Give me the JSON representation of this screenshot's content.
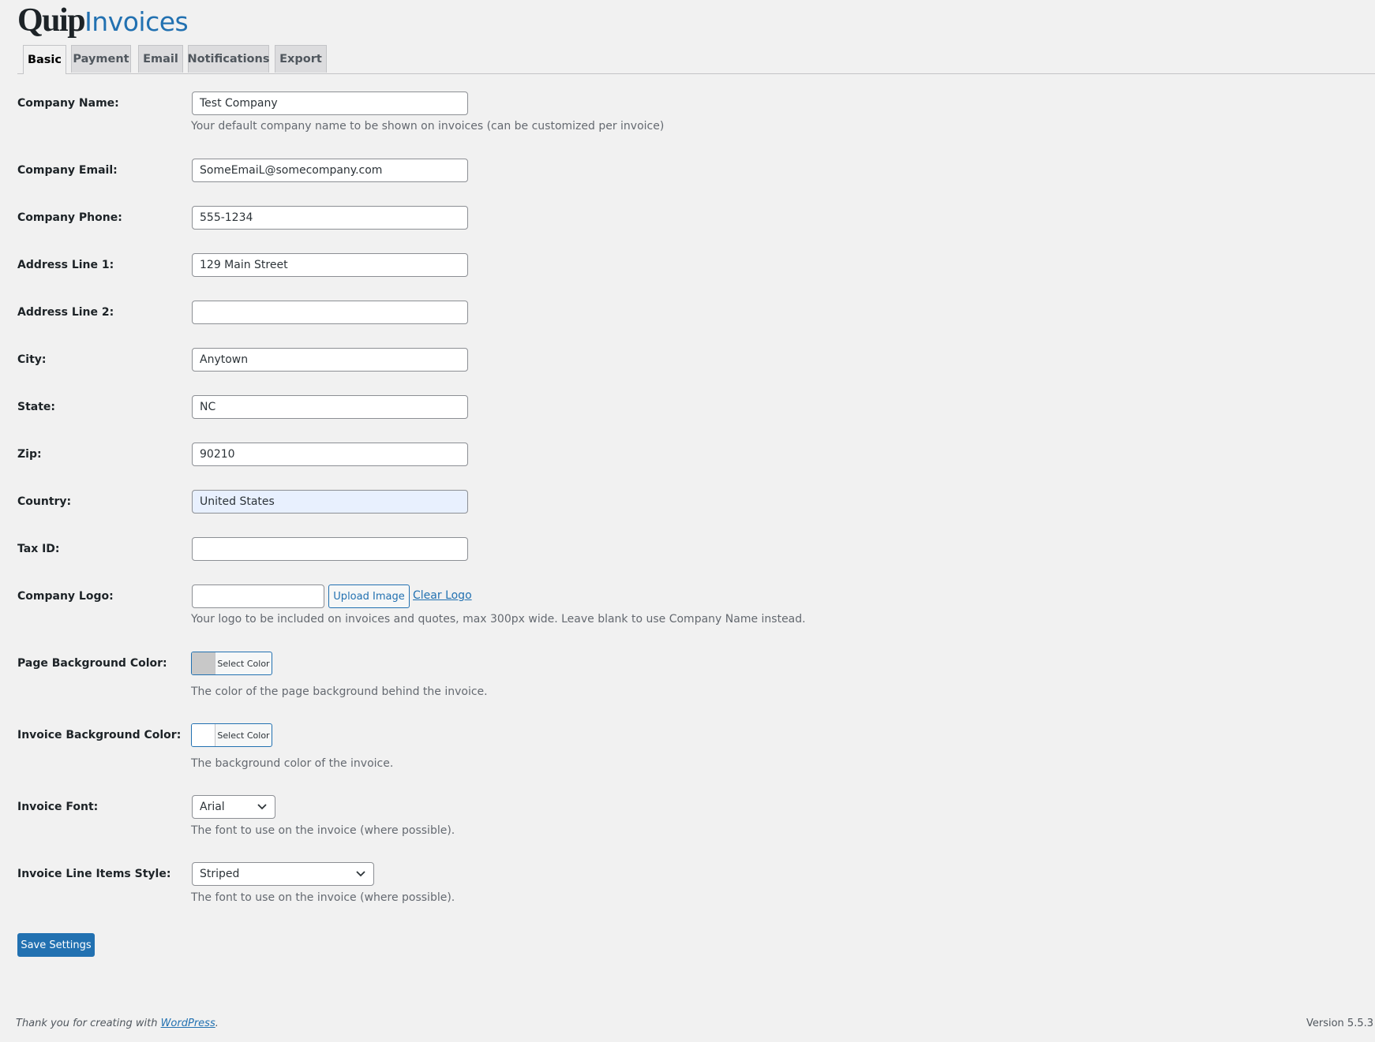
{
  "brand": {
    "part1": "Quip",
    "part2": "Invoices"
  },
  "tabs": [
    {
      "label": "Basic",
      "active": true
    },
    {
      "label": "Payment"
    },
    {
      "label": "Email"
    },
    {
      "label": "Notifications"
    },
    {
      "label": "Export"
    }
  ],
  "fields": {
    "company_name": {
      "label": "Company Name:",
      "value": "Test Company",
      "description": "Your default company name to be shown on invoices (can be customized per invoice)"
    },
    "company_email": {
      "label": "Company Email:",
      "value": "SomeEmaiL@somecompany.com"
    },
    "company_phone": {
      "label": "Company Phone:",
      "value": "555-1234"
    },
    "address1": {
      "label": "Address Line 1:",
      "value": "129 Main Street"
    },
    "address2": {
      "label": "Address Line 2:",
      "value": ""
    },
    "city": {
      "label": "City:",
      "value": "Anytown"
    },
    "state": {
      "label": "State:",
      "value": "NC"
    },
    "zip": {
      "label": "Zip:",
      "value": "90210"
    },
    "country": {
      "label": "Country:",
      "value": "United States"
    },
    "tax_id": {
      "label": "Tax ID:",
      "value": ""
    },
    "company_logo": {
      "label": "Company Logo:",
      "value": "",
      "upload_label": "Upload Image",
      "clear_label": "Clear Logo",
      "description": "Your logo to be included on invoices and quotes, max 300px wide. Leave blank to use Company Name instead."
    },
    "page_bg_color": {
      "label": "Page Background Color:",
      "button": "Select Color",
      "swatch": "#c8c8c8",
      "description": "The color of the page background behind the invoice."
    },
    "invoice_bg_color": {
      "label": "Invoice Background Color:",
      "button": "Select Color",
      "swatch": "#ffffff",
      "description": "The background color of the invoice."
    },
    "invoice_font": {
      "label": "Invoice Font:",
      "value": "Arial",
      "description": "The font to use on the invoice (where possible)."
    },
    "line_items_style": {
      "label": "Invoice Line Items Style:",
      "value": "Striped",
      "description": "The font to use on the invoice (where possible)."
    }
  },
  "actions": {
    "save_label": "Save Settings"
  },
  "footer": {
    "text": "Thank you for creating with ",
    "link": "WordPress",
    "end": ".",
    "version": "Version 5.5.3"
  },
  "colors": {
    "accent": "#2271b1",
    "background": "#f1f1f1"
  },
  "icons": {
    "select_arrow": "chevron-down-icon"
  }
}
